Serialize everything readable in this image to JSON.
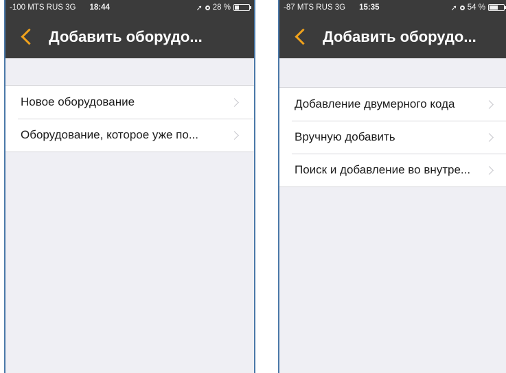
{
  "left": {
    "status": {
      "carrier": "-100 MTS RUS  3G",
      "time": "18:44",
      "battery": "28 %",
      "battery_level": 0.28
    },
    "title": "Добавить оборудо...",
    "rows": [
      {
        "label": "Новое оборудование"
      },
      {
        "label": "Оборудование, которое уже по..."
      }
    ]
  },
  "right": {
    "status": {
      "carrier": "-87 MTS RUS  3G",
      "time": "15:35",
      "battery": "54 %",
      "battery_level": 0.54
    },
    "title": "Добавить оборудо...",
    "rows": [
      {
        "label": "Добавление двумерного кода"
      },
      {
        "label": "Вручную добавить"
      },
      {
        "label": "Поиск и добавление во внутре..."
      }
    ]
  },
  "colors": {
    "accent": "#f0a21c",
    "navbar": "#3b3b3b",
    "background": "#efeff4"
  },
  "icons": {
    "back": "chevron-left-icon",
    "disclosure": "chevron-right-icon",
    "location": "location-arrow-icon",
    "alarm": "alarm-icon",
    "battery": "battery-icon"
  }
}
